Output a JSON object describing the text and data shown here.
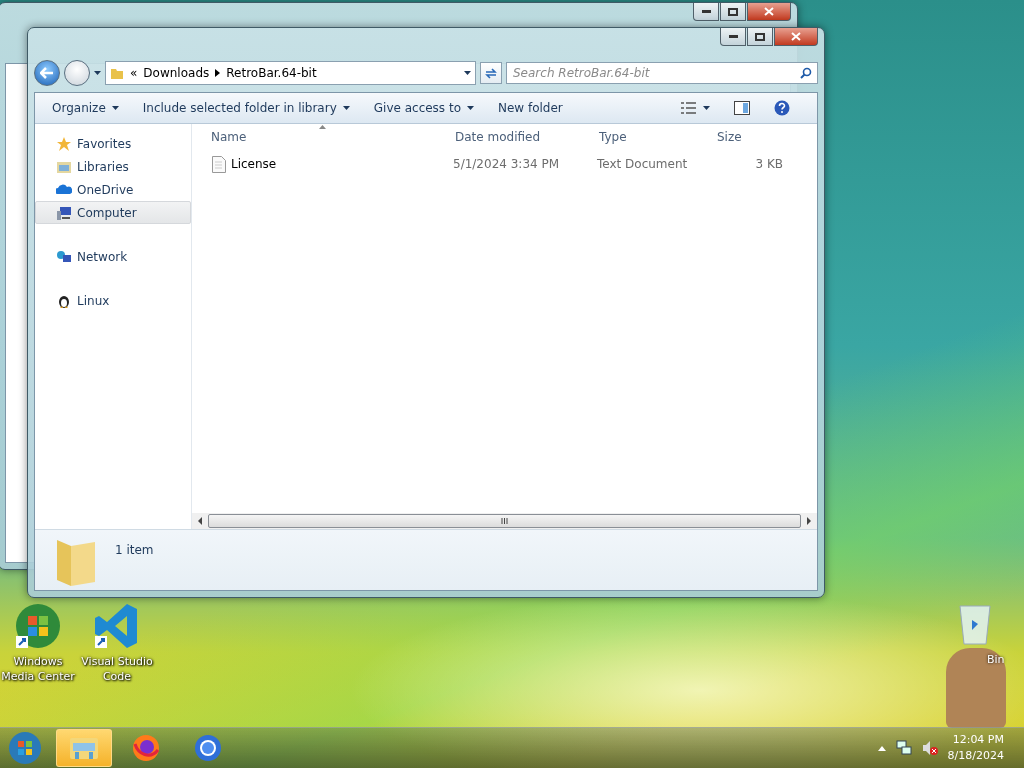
{
  "desktop": {
    "icons": [
      {
        "label": "Windows Media Center",
        "kind": "wmc"
      },
      {
        "label": "Visual Studio Code",
        "kind": "vscode"
      }
    ],
    "recycle_bin": {
      "label": "Bin"
    }
  },
  "window": {
    "address": {
      "overflow": "«",
      "segments": [
        "Downloads",
        "RetroBar.64-bit"
      ]
    },
    "search": {
      "placeholder": "Search RetroBar.64-bit"
    },
    "commands": [
      {
        "label": "Organize",
        "dropdown": true
      },
      {
        "label": "Include selected folder in library",
        "dropdown": true
      },
      {
        "label": "Give access to",
        "dropdown": true
      },
      {
        "label": "New folder",
        "dropdown": false
      }
    ],
    "nav_groups": [
      {
        "items": [
          {
            "label": "Favorites",
            "kind": "star",
            "selected": false
          },
          {
            "label": "Libraries",
            "kind": "library",
            "selected": false
          },
          {
            "label": "OneDrive",
            "kind": "cloud",
            "selected": false
          },
          {
            "label": "Computer",
            "kind": "computer",
            "selected": true
          }
        ]
      },
      {
        "items": [
          {
            "label": "Network",
            "kind": "network",
            "selected": false
          }
        ]
      },
      {
        "items": [
          {
            "label": "Linux",
            "kind": "penguin",
            "selected": false
          }
        ]
      }
    ],
    "columns": [
      {
        "label": "Name",
        "sorted": true
      },
      {
        "label": "Date modified",
        "sorted": false
      },
      {
        "label": "Type",
        "sorted": false
      },
      {
        "label": "Size",
        "sorted": false
      }
    ],
    "files": [
      {
        "name": "License",
        "date": "5/1/2024 3:34 PM",
        "type": "Text Document",
        "size": "3 KB",
        "selected": false
      }
    ],
    "details": {
      "count": "1 item"
    }
  },
  "taskbar": {
    "items": [
      {
        "kind": "explorer",
        "selected": true
      },
      {
        "kind": "firefox",
        "selected": false
      },
      {
        "kind": "chrome",
        "selected": false
      }
    ],
    "clock": {
      "time": "12:04 PM",
      "date": "8/18/2024"
    }
  }
}
